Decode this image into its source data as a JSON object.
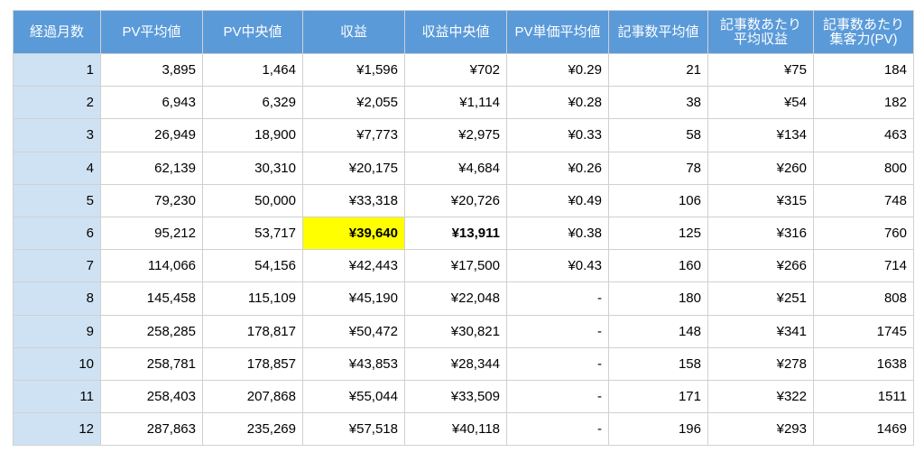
{
  "table": {
    "headers": [
      {
        "line1": "経過月数",
        "line2": ""
      },
      {
        "line1": "PV平均値",
        "line2": ""
      },
      {
        "line1": "PV中央値",
        "line2": ""
      },
      {
        "line1": "収益",
        "line2": ""
      },
      {
        "line1": "収益中央値",
        "line2": ""
      },
      {
        "line1": "PV単価平均値",
        "line2": ""
      },
      {
        "line1": "記事数平均値",
        "line2": ""
      },
      {
        "line1": "記事数あたり",
        "line2": "平均収益"
      },
      {
        "line1": "記事数あたり",
        "line2": "集客力(PV)"
      }
    ],
    "rows": [
      [
        "1",
        "3,895",
        "1,464",
        "¥1,596",
        "¥702",
        "¥0.29",
        "21",
        "¥75",
        "184"
      ],
      [
        "2",
        "6,943",
        "6,329",
        "¥2,055",
        "¥1,114",
        "¥0.28",
        "38",
        "¥54",
        "182"
      ],
      [
        "3",
        "26,949",
        "18,900",
        "¥7,773",
        "¥2,975",
        "¥0.33",
        "58",
        "¥134",
        "463"
      ],
      [
        "4",
        "62,139",
        "30,310",
        "¥20,175",
        "¥4,684",
        "¥0.26",
        "78",
        "¥260",
        "800"
      ],
      [
        "5",
        "79,230",
        "50,000",
        "¥33,318",
        "¥20,726",
        "¥0.49",
        "106",
        "¥315",
        "748"
      ],
      [
        "6",
        "95,212",
        "53,717",
        "¥39,640",
        "¥13,911",
        "¥0.38",
        "125",
        "¥316",
        "760"
      ],
      [
        "7",
        "114,066",
        "54,156",
        "¥42,443",
        "¥17,500",
        "¥0.43",
        "160",
        "¥266",
        "714"
      ],
      [
        "8",
        "145,458",
        "115,109",
        "¥45,190",
        "¥22,048",
        "-",
        "180",
        "¥251",
        "808"
      ],
      [
        "9",
        "258,285",
        "178,817",
        "¥50,472",
        "¥30,821",
        "-",
        "148",
        "¥341",
        "1745"
      ],
      [
        "10",
        "258,781",
        "178,857",
        "¥43,853",
        "¥28,344",
        "-",
        "158",
        "¥278",
        "1638"
      ],
      [
        "11",
        "258,403",
        "207,868",
        "¥55,044",
        "¥33,509",
        "-",
        "171",
        "¥322",
        "1511"
      ],
      [
        "12",
        "287,863",
        "235,269",
        "¥57,518",
        "¥40,118",
        "-",
        "196",
        "¥293",
        "1469"
      ]
    ],
    "highlight": {
      "row": 5,
      "col": 3,
      "color": "#ffff00"
    },
    "bold_cells": [
      [
        5,
        3
      ],
      [
        5,
        4
      ]
    ],
    "colors": {
      "header_bg": "#5a9ad9",
      "header_text": "#ffffff",
      "month_col_bg": "#cfe2f3"
    }
  }
}
